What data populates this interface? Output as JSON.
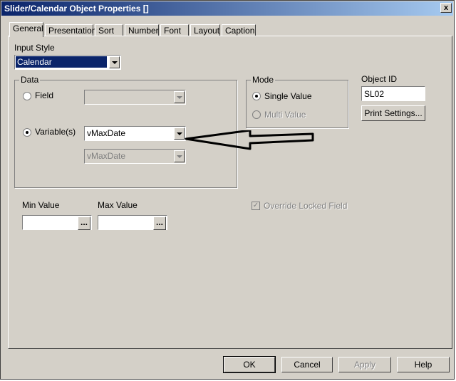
{
  "window": {
    "title": "Slider/Calendar Object Properties []",
    "close": "x"
  },
  "tabs": [
    "General",
    "Presentation",
    "Sort",
    "Number",
    "Font",
    "Layout",
    "Caption"
  ],
  "input_style": {
    "label": "Input Style",
    "value": "Calendar"
  },
  "data_group": {
    "title": "Data",
    "field_label": "Field",
    "field_value": "",
    "variables_label": "Variable(s)",
    "variable1": "vMaxDate",
    "variable2": "vMaxDate"
  },
  "mode_group": {
    "title": "Mode",
    "single": "Single Value",
    "multi": "Multi Value"
  },
  "object_id": {
    "label": "Object ID",
    "value": "SL02"
  },
  "print_settings": "Print Settings...",
  "min_value": {
    "label": "Min Value",
    "value": "",
    "button": "..."
  },
  "max_value": {
    "label": "Max Value",
    "value": "",
    "button": "..."
  },
  "override_locked": {
    "label": "Override Locked Field",
    "check": "✓"
  },
  "footer": {
    "ok": "OK",
    "cancel": "Cancel",
    "apply": "Apply",
    "help": "Help"
  }
}
